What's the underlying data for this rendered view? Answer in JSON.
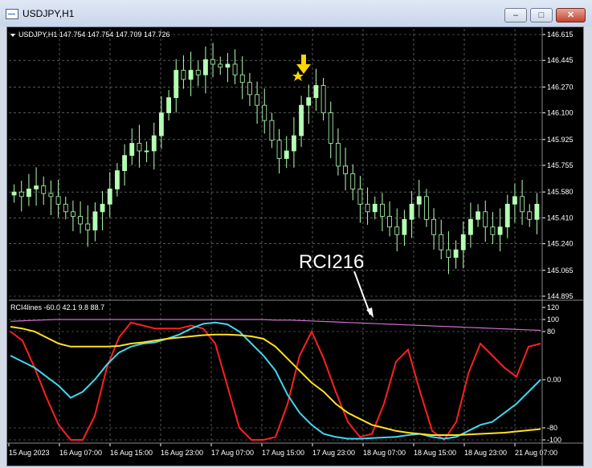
{
  "window": {
    "title": "USDJPY,H1",
    "minimize_symbol": "–",
    "maximize_symbol": "□",
    "close_symbol": "✕"
  },
  "main_chart": {
    "info": "USDJPY,H1  147.754 147.754 147.709 147.726",
    "price_ticks": [
      "146.615",
      "146.445",
      "146.270",
      "146.100",
      "145.925",
      "145.755",
      "145.580",
      "145.410",
      "145.240",
      "145.065",
      "144.895"
    ]
  },
  "annotation": {
    "text": "RCI216",
    "star_icon": "star-icon",
    "arrow_icon": "down-arrow-icon",
    "color": "#ffd700"
  },
  "indicator": {
    "label": "RCI4lines -60.0 42.1 9.8 88.7",
    "level_ticks": [
      "120",
      "100",
      "80",
      "0.00",
      "-80",
      "-100"
    ]
  },
  "time_axis": [
    "15 Aug 2023",
    "16 Aug 07:00",
    "16 Aug 15:00",
    "16 Aug 23:00",
    "17 Aug 07:00",
    "17 Aug 15:00",
    "17 Aug 23:00",
    "18 Aug 07:00",
    "18 Aug 15:00",
    "18 Aug 23:00",
    "21 Aug 07:00"
  ],
  "colors": {
    "candle": "#b4ffb4",
    "grid": "#8a8a8a",
    "red": "#ff2020",
    "cyan": "#40d8f0",
    "yellow": "#ffe020",
    "magenta": "#d070d0"
  },
  "chart_data": [
    {
      "type": "candlestick",
      "title": "USDJPY,H1",
      "ylim": [
        144.895,
        146.615
      ],
      "close": [
        145.58,
        145.55,
        145.6,
        145.62,
        145.57,
        145.55,
        145.5,
        145.45,
        145.42,
        145.37,
        145.33,
        145.45,
        145.5,
        145.6,
        145.72,
        145.82,
        145.9,
        145.85,
        145.85,
        145.95,
        146.1,
        146.2,
        146.38,
        146.32,
        146.38,
        146.35,
        146.45,
        146.42,
        146.4,
        146.42,
        146.35,
        146.3,
        146.22,
        146.15,
        146.05,
        145.92,
        145.8,
        145.85,
        145.95,
        146.15,
        146.2,
        146.28,
        146.1,
        145.9,
        145.75,
        145.7,
        145.6,
        145.5,
        145.45,
        145.5,
        145.42,
        145.35,
        145.3,
        145.4,
        145.5,
        145.55,
        145.4,
        145.3,
        145.2,
        145.15,
        145.2,
        145.3,
        145.4,
        145.45,
        145.35,
        145.3,
        145.35,
        145.5,
        145.55,
        145.45,
        145.4,
        145.5
      ]
    },
    {
      "type": "line",
      "title": "RCI4lines -60.0 42.1 9.8 88.7",
      "ylim": [
        -100,
        120
      ],
      "series": [
        {
          "values": [
            80,
            65,
            20,
            -30,
            -75,
            -100,
            -100,
            -60,
            20,
            70,
            95,
            90,
            85,
            85,
            85,
            90,
            85,
            60,
            -10,
            -80,
            -100,
            -100,
            -95,
            -40,
            40,
            80,
            35,
            -20,
            -70,
            -95,
            -90,
            -40,
            30,
            50,
            -20,
            -85,
            -100,
            -70,
            10,
            60,
            40,
            20,
            5,
            55,
            60
          ]
        },
        {
          "values": [
            40,
            30,
            20,
            5,
            -10,
            -30,
            -20,
            0,
            25,
            45,
            55,
            60,
            62,
            68,
            75,
            85,
            93,
            95,
            92,
            80,
            60,
            40,
            15,
            -25,
            -55,
            -75,
            -90,
            -95,
            -98,
            -98,
            -97,
            -96,
            -95,
            -92,
            -90,
            -95,
            -98,
            -95,
            -85,
            -75,
            -70,
            -55,
            -40,
            -20,
            0
          ]
        },
        {
          "values": [
            88,
            85,
            80,
            70,
            60,
            55,
            55,
            55,
            55,
            56,
            60,
            62,
            65,
            68,
            70,
            72,
            74,
            75,
            75,
            74,
            72,
            68,
            55,
            35,
            15,
            -5,
            -20,
            -40,
            -55,
            -65,
            -75,
            -80,
            -85,
            -88,
            -90,
            -92,
            -92,
            -92,
            -91,
            -90,
            -89,
            -88,
            -86,
            -84,
            -82
          ]
        },
        {
          "values": [
            97,
            98,
            99,
            100,
            100,
            100,
            100,
            100,
            100,
            100,
            100,
            100,
            100,
            100,
            100,
            100,
            100,
            100,
            99,
            99,
            98,
            97,
            96,
            95,
            94,
            93,
            92,
            91,
            90,
            89,
            88,
            87,
            86,
            85,
            84,
            83,
            82
          ]
        }
      ]
    }
  ]
}
